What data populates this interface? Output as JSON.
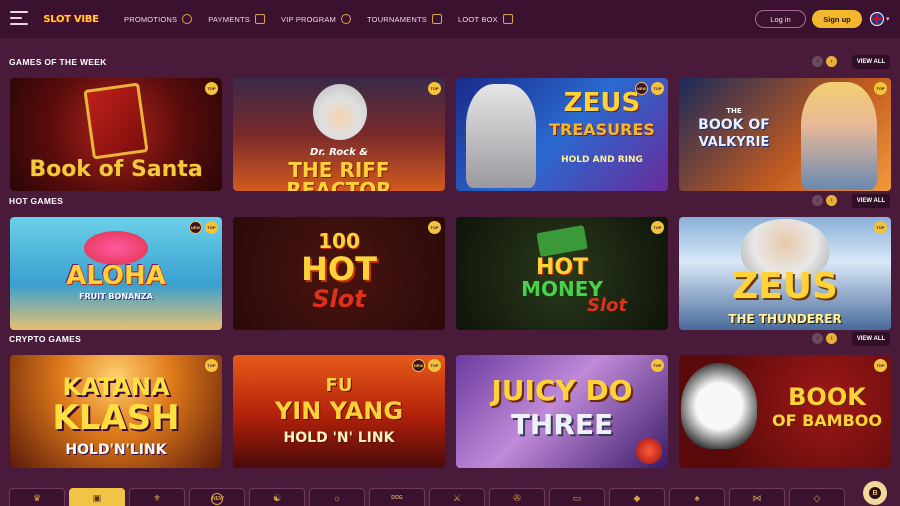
{
  "header": {
    "logo_text": "SLOT VIBE",
    "nav": [
      {
        "label": "PROMOTIONS",
        "icon": "gift-icon"
      },
      {
        "label": "PAYMENTS",
        "icon": "tag-icon"
      },
      {
        "label": "VIP PROGRAM",
        "icon": "crown-icon"
      },
      {
        "label": "TOURNAMENTS",
        "icon": "ticket-icon"
      },
      {
        "label": "LOOT BOX",
        "icon": "tag-icon"
      }
    ],
    "login_label": "Log in",
    "signup_label": "Sign up",
    "language_icon": "uk-flag-icon"
  },
  "colors": {
    "background": "#4a1a3a",
    "header": "#3a1230",
    "accent": "#f2b72a"
  },
  "sections": [
    {
      "title": "GAMES OF THE WEEK",
      "view_all": "VIEW ALL",
      "games": [
        {
          "line1": "Book of Santa",
          "line2": "",
          "line3": "",
          "badges": [
            "TOP"
          ]
        },
        {
          "line1": "Dr. Rock &",
          "line2": "THE RIFF REACTOR",
          "line3": "",
          "badges": [
            "TOP"
          ]
        },
        {
          "line1": "ZEUS",
          "line2": "TREASURES",
          "line3": "HOLD AND RING",
          "badges": [
            "NEW",
            "TOP"
          ]
        },
        {
          "line1": "THE",
          "line2": "BOOK OF",
          "line3": "VALKYRIE",
          "badges": [
            "TOP"
          ]
        }
      ]
    },
    {
      "title": "HOT GAMES",
      "view_all": "VIEW ALL",
      "games": [
        {
          "line1": "ALOHA",
          "line2": "FRUIT BONANZA",
          "line3": "",
          "badges": [
            "NEW",
            "TOP"
          ]
        },
        {
          "line1": "100",
          "line2": "HOT",
          "line3": "Slot",
          "badges": [
            "TOP"
          ]
        },
        {
          "line1": "HOT",
          "line2": "MONEY",
          "line3": "Slot",
          "badges": [
            "TOP"
          ]
        },
        {
          "line1": "ZEUS",
          "line2": "THE THUNDERER",
          "line3": "",
          "badges": [
            "TOP"
          ]
        }
      ]
    },
    {
      "title": "CRYPTO GAMES",
      "view_all": "VIEW ALL",
      "games": [
        {
          "line1": "KATANA",
          "line2": "KLASH",
          "line3": "HOLD'N'LINK",
          "badges": [
            "TOP"
          ]
        },
        {
          "line1": "FU",
          "line2": "YIN YANG",
          "line3": "HOLD 'N' LINK",
          "badges": [
            "NEW",
            "TOP"
          ]
        },
        {
          "line1": "JUICY DO",
          "line2": "THREE",
          "line3": "",
          "badges": [
            "TOP"
          ]
        },
        {
          "line1": "BOOK",
          "line2": "OF BAMBOO",
          "line3": "",
          "badges": [
            "TOP"
          ]
        }
      ]
    }
  ],
  "category_bar": {
    "items": [
      {
        "icon": "slots-icon"
      },
      {
        "icon": "gift-box-icon"
      },
      {
        "icon": "fleur-icon"
      },
      {
        "icon": "new-icon",
        "label": "NEW"
      },
      {
        "icon": "dragon-icon"
      },
      {
        "icon": "sun-icon"
      },
      {
        "icon": "dog-icon",
        "label": "DOG"
      },
      {
        "icon": "swords-icon"
      },
      {
        "icon": "wheel-icon"
      },
      {
        "icon": "tv-icon"
      },
      {
        "icon": "tag-icon"
      },
      {
        "icon": "cards-icon"
      },
      {
        "icon": "bow-icon"
      },
      {
        "icon": "diamond-icon"
      }
    ],
    "active_index": 1
  },
  "floating_button_letter": "B"
}
